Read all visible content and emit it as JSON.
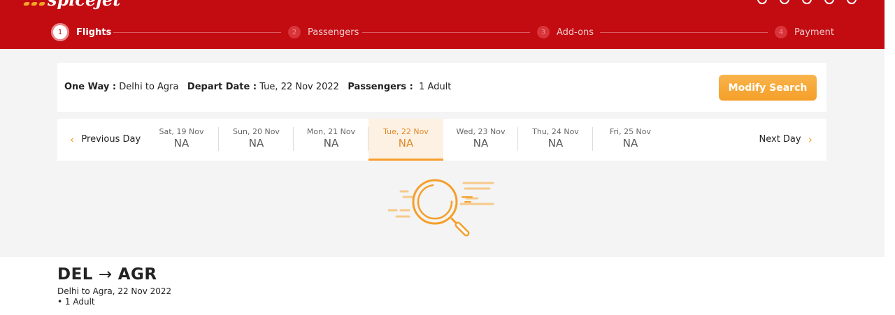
{
  "brand": {
    "name": "spicejet"
  },
  "stepper": [
    {
      "num": "1",
      "label": "Flights"
    },
    {
      "num": "2",
      "label": "Passengers"
    },
    {
      "num": "3",
      "label": "Add-ons"
    },
    {
      "num": "4",
      "label": "Payment"
    }
  ],
  "summary": {
    "trip_label": "One Way :",
    "trip_value": "Delhi to Agra",
    "depart_label": "Depart Date :",
    "depart_value": "Tue, 22 Nov 2022",
    "pax_label": "Passengers :",
    "pax_value": "1 Adult",
    "modify_label": "Modify Search"
  },
  "datebar": {
    "prev_label": "Previous Day",
    "next_label": "Next Day",
    "dates": [
      {
        "label": "Sat, 19 Nov",
        "value": "NA"
      },
      {
        "label": "Sun, 20 Nov",
        "value": "NA"
      },
      {
        "label": "Mon, 21 Nov",
        "value": "NA"
      },
      {
        "label": "Tue, 22 Nov",
        "value": "NA"
      },
      {
        "label": "Wed, 23 Nov",
        "value": "NA"
      },
      {
        "label": "Thu, 24 Nov",
        "value": "NA"
      },
      {
        "label": "Fri, 25 Nov",
        "value": "NA"
      }
    ],
    "selected_index": 3
  },
  "route": {
    "from": "DEL",
    "arrow": "→",
    "to": "AGR",
    "line1": "Delhi to Agra, 22 Nov 2022",
    "line2": "• 1 Adult"
  },
  "icons": {
    "loader": "searching-magnifier-icon"
  },
  "colors": {
    "brand_red": "#c20c12",
    "accent_orange": "#f59f2a"
  }
}
